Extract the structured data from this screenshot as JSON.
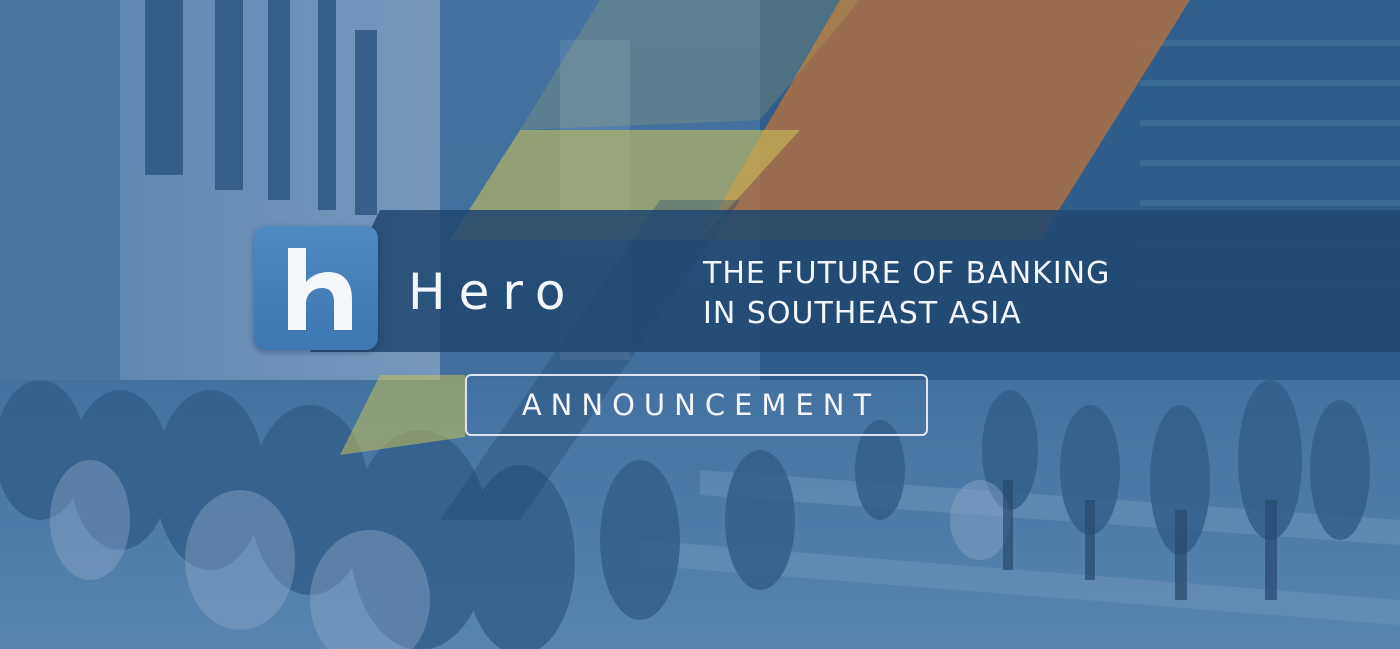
{
  "brand": {
    "name": "Hero",
    "logo_letter": "h"
  },
  "headline": {
    "line1": "THE FUTURE OF BANKING",
    "line2": "IN SOUTHEAST ASIA"
  },
  "badge": {
    "label": "ANNOUNCEMENT"
  },
  "colors": {
    "overlay_blue": "#2f5f8f",
    "panel_navy": "#1f4770",
    "accent_yellow": "#c9c05a",
    "accent_orange": "#b5703f",
    "logo_blue": "#4a85bd",
    "text_white": "#f3f6fa"
  },
  "icons": {
    "logo": "hero-h-logo-icon"
  }
}
